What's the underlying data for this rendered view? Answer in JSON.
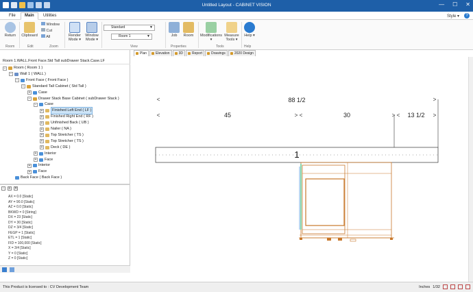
{
  "titlebar": {
    "title": "Untitled Layout - CABINET VISION",
    "minimize": "—",
    "maximize": "☐",
    "close": "✕"
  },
  "menu": {
    "tabs": [
      {
        "label": "File"
      },
      {
        "label": "Main"
      },
      {
        "label": "Utilities"
      }
    ],
    "style_label": "Style ▾",
    "help_label": "?"
  },
  "ribbon": {
    "buttons": {
      "return": "Return",
      "clipboard": "Clipboard",
      "window": "Window",
      "cut": "Cut",
      "all": "All",
      "render": "Render Mode ▾",
      "window_mode": "Window Mode ▾",
      "job": "Job",
      "room": "Room",
      "modifications": "Modifications ▾",
      "measure": "Measure Tools ▾",
      "help": "Help ▾"
    },
    "combos": {
      "style": "Standard",
      "room": "Room 1"
    },
    "groups": {
      "room": "Room",
      "edit": "Edit",
      "zoom": "Zoom",
      "view": "View",
      "properties": "Properties",
      "tools": "Tools",
      "help": "Help"
    }
  },
  "left": {
    "path": "Room 1.WALL.Front Face.Std Tall subDrawer Stack.Case.LF",
    "tree": [
      {
        "label": "Room ( Room 1 )",
        "toggle": "−",
        "depth": 0,
        "icon": "#d9a33a"
      },
      {
        "label": "Wall 1 ( WALL )",
        "toggle": "−",
        "depth": 1,
        "icon": "#6a8fc8"
      },
      {
        "label": "Front Face ( Front Face )",
        "toggle": "−",
        "depth": 2,
        "icon": "#4a90d9"
      },
      {
        "label": "Standard Tall Cabinet ( Std Tall )",
        "toggle": "−",
        "depth": 3,
        "icon": "#d9a33a"
      },
      {
        "label": "Case",
        "toggle": "+",
        "depth": 4,
        "icon": "#4a90d9"
      },
      {
        "label": "Drawer Stack Base Cabinet ( subDrawer Stack )",
        "toggle": "−",
        "depth": 4,
        "icon": "#d9a33a"
      },
      {
        "label": "Case",
        "toggle": "−",
        "depth": 5,
        "icon": "#4a90d9"
      },
      {
        "label": "Finished Left End ( LF )",
        "toggle": "+",
        "depth": 6,
        "icon": "#e0b860",
        "selected": true
      },
      {
        "label": "Finished Right End ( RF )",
        "toggle": "+",
        "depth": 6,
        "icon": "#e0b860"
      },
      {
        "label": "Unfinished Back ( UB )",
        "toggle": "+",
        "depth": 6,
        "icon": "#e0b860"
      },
      {
        "label": "Nailer ( NA )",
        "toggle": "+",
        "depth": 6,
        "icon": "#e0b860"
      },
      {
        "label": "Top Stretcher ( TS )",
        "toggle": "+",
        "depth": 6,
        "icon": "#e0b860"
      },
      {
        "label": "Top Stretcher ( TS )",
        "toggle": "+",
        "depth": 6,
        "icon": "#e0b860"
      },
      {
        "label": "Deck ( DE )",
        "toggle": "+",
        "depth": 6,
        "icon": "#e0b860"
      },
      {
        "label": "Interior",
        "toggle": "+",
        "depth": 5,
        "icon": "#4a90d9"
      },
      {
        "label": "Face",
        "toggle": "+",
        "depth": 5,
        "icon": "#4a90d9"
      },
      {
        "label": "Interior",
        "toggle": "+",
        "depth": 4,
        "icon": "#4a90d9"
      },
      {
        "label": "Face",
        "toggle": "+",
        "depth": 4,
        "icon": "#4a90d9"
      },
      {
        "label": "Back Face ( Back Face )",
        "toggle": "",
        "depth": 2,
        "icon": "#4a90d9"
      }
    ],
    "properties": [
      "AX = 0.0 [Static]",
      "AY = 90.0 [Static]",
      "AZ = 0.0 [Static]",
      "BKWD = 0 [String]",
      "DX = 23 [Static]",
      "DY = 30 [Static]",
      "DZ = 3/4 [Static]",
      "FEGP = 1 [Static]",
      "ETL = 1 [Static]",
      "FID = 100,000 [Static]",
      "X = 3/4 [Static]",
      "Y = 0 [Static]",
      "Z = 0 [Static]"
    ]
  },
  "main": {
    "tabs": [
      {
        "label": "Plan"
      },
      {
        "label": "Elevation"
      },
      {
        "label": "3D"
      },
      {
        "label": "Report"
      },
      {
        "label": "Drawings"
      },
      {
        "label": "2020 Design"
      }
    ],
    "dims": {
      "overall": "88 1/2",
      "left": "45",
      "mid": "30",
      "right": "13 1/2",
      "marker": "1"
    }
  },
  "status": {
    "message": "This Product is licensed to : CV Development Team",
    "units": "Inches",
    "scale": "1/32"
  }
}
